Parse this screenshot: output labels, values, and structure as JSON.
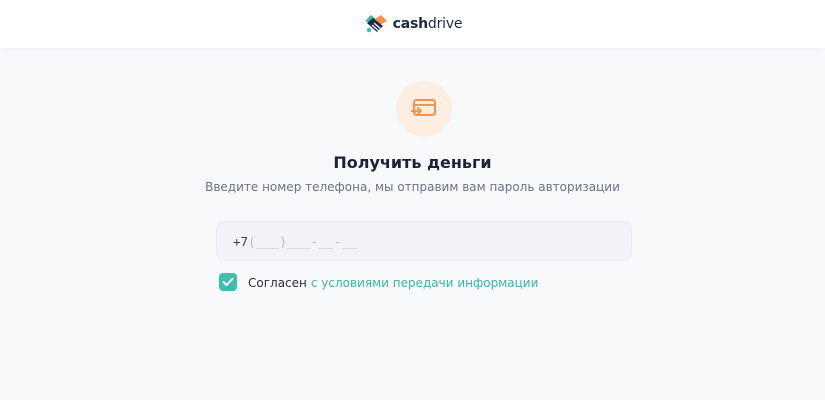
{
  "header": {
    "logo_bold": "cash",
    "logo_light": "drive"
  },
  "main": {
    "icon": "card-transfer-icon",
    "title": "Получить деньги",
    "subtitle": "Введите номер телефона, мы отправим вам пароль авторизации",
    "phone": {
      "prefix": "+7",
      "mask": "(___)___-__-__",
      "value": ""
    },
    "consent": {
      "checked": true,
      "text": "Согласен",
      "link_text": "с условиями передачи информации"
    }
  },
  "colors": {
    "accent": "#3fbdae",
    "link": "#3fb3a6",
    "icon_orange": "#f4934d",
    "icon_bg": "#fdeee2"
  }
}
